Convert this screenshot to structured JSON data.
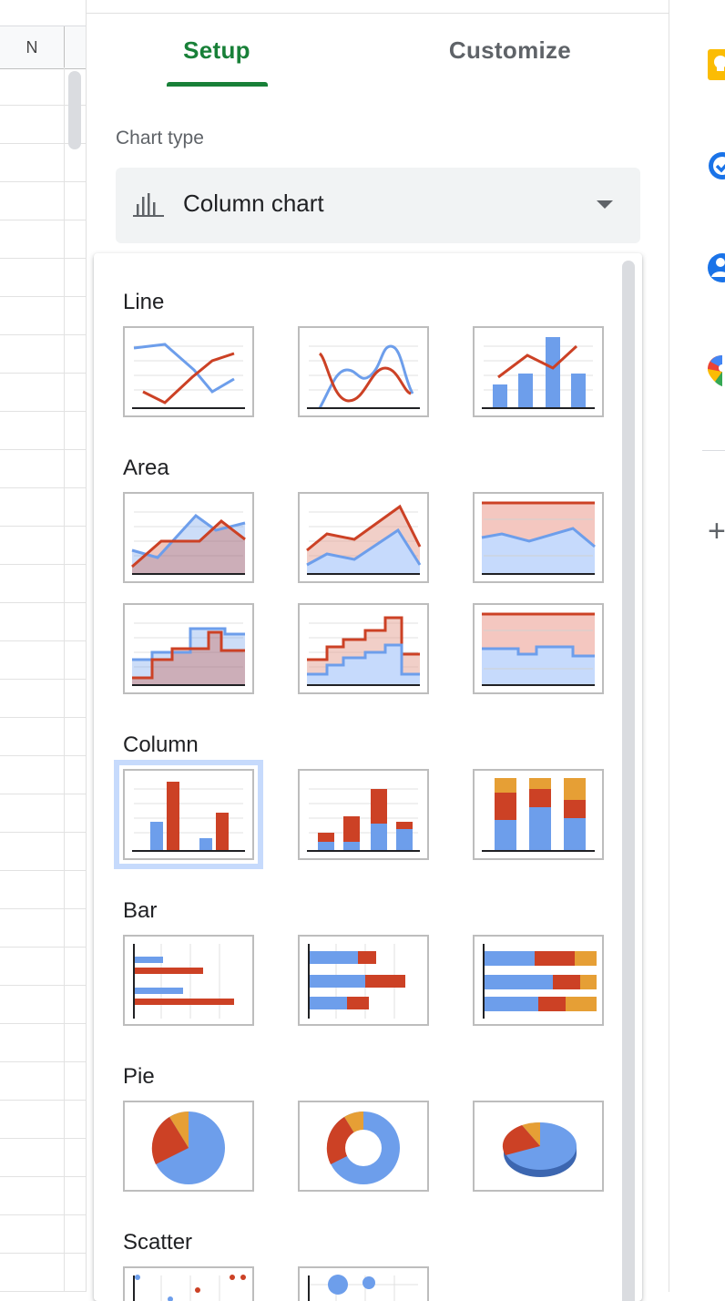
{
  "sheet": {
    "column_label": "N"
  },
  "tabs": {
    "setup": "Setup",
    "customize": "Customize",
    "active": "Setup"
  },
  "chart_type": {
    "label": "Chart type",
    "value": "Column chart",
    "icon": "column-chart-icon"
  },
  "dropdown": {
    "sections": {
      "line": "Line",
      "area": "Area",
      "column": "Column",
      "bar": "Bar",
      "pie": "Pie",
      "scatter": "Scatter"
    },
    "options": [
      "line-chart",
      "smooth-line-chart",
      "combo-chart",
      "area-chart",
      "stacked-area-chart",
      "100-stacked-area-chart",
      "stepped-area-chart",
      "stacked-stepped-area-chart",
      "100-stacked-stepped-area-chart",
      "column-chart",
      "stacked-column-chart",
      "100-stacked-column-chart",
      "bar-chart",
      "stacked-bar-chart",
      "100-stacked-bar-chart",
      "pie-chart",
      "doughnut-chart",
      "3d-pie-chart",
      "scatter-chart",
      "bubble-chart"
    ],
    "selected": "column-chart"
  },
  "colors": {
    "blue": "#6d9eeb",
    "red": "#cc4125",
    "orange": "#e69f35",
    "green_accent": "#188038",
    "selected_outline": "#c6dafc"
  },
  "rail": {
    "icons": [
      "keep-icon",
      "tasks-icon",
      "contacts-icon",
      "maps-icon",
      "add-icon"
    ]
  }
}
